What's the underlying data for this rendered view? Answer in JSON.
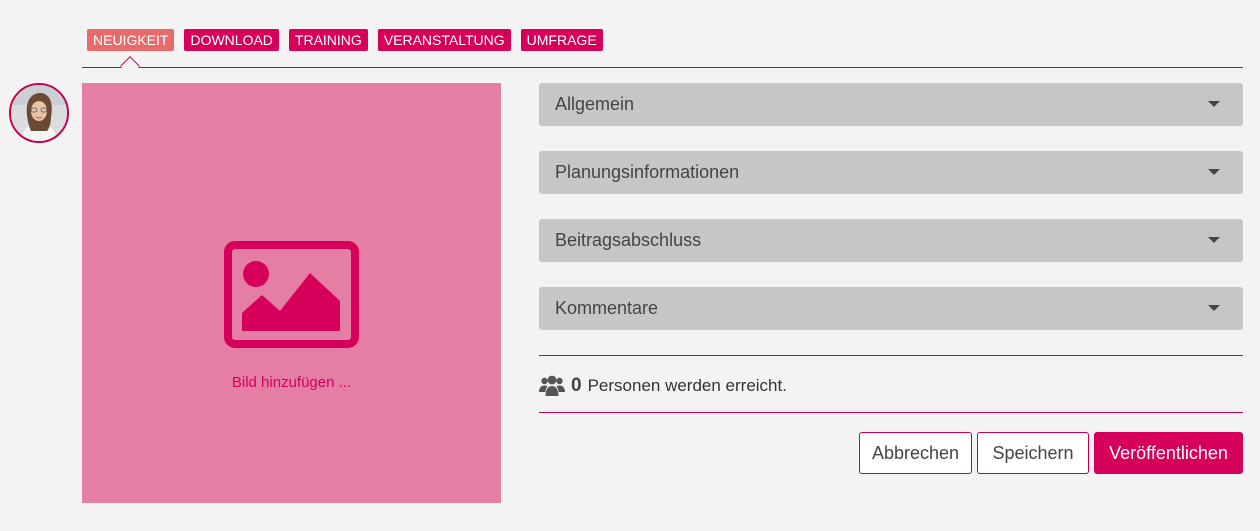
{
  "tabs": [
    {
      "label": "NEUIGKEIT",
      "active": true
    },
    {
      "label": "DOWNLOAD",
      "active": false
    },
    {
      "label": "TRAINING",
      "active": false
    },
    {
      "label": "VERANSTALTUNG",
      "active": false
    },
    {
      "label": "UMFRAGE",
      "active": false
    }
  ],
  "image_upload": {
    "label": "Bild hinzufügen ...",
    "icon": "image-placeholder-icon"
  },
  "sections": [
    {
      "label": "Allgemein"
    },
    {
      "label": "Planungsinformationen"
    },
    {
      "label": "Beitragsabschluss"
    },
    {
      "label": "Kommentare"
    }
  ],
  "reach": {
    "count": "0",
    "text": "Personen werden erreicht.",
    "icon": "people-icon"
  },
  "buttons": {
    "cancel": "Abbrechen",
    "save": "Speichern",
    "publish": "Veröffentlichen"
  },
  "colors": {
    "brand": "#d6005b",
    "tab_active": "#e76b6b",
    "image_bg": "#e47ea5",
    "accordion_bg": "#c6c6c6",
    "page_bg": "#f3f3f3"
  }
}
